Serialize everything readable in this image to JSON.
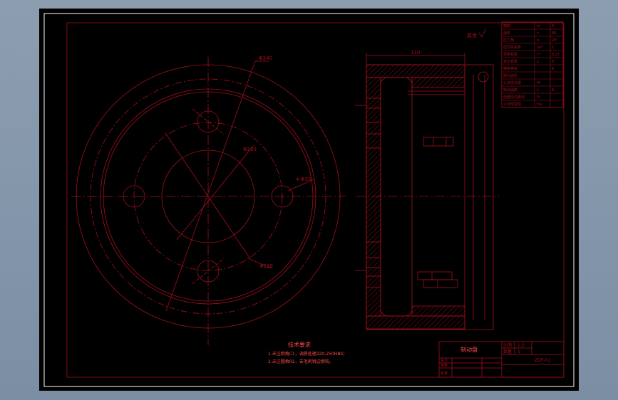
{
  "colors": {
    "frame_background": "#000000",
    "drawing_lines": "#a3101a",
    "outer_background": "#8b9bb0",
    "paper_border": "#ffffff"
  },
  "drawing": {
    "roughness_note": "其余",
    "dim_outer_diameter": "Φ340",
    "dim_pitch_circle": "Φ200",
    "dim_hole_spec": "4-Φ30",
    "dim_bore": "Φ120",
    "dim_width": "110"
  },
  "parameter_table": {
    "rows": [
      {
        "label": "模数",
        "code": "m",
        "value": "4"
      },
      {
        "label": "齿数",
        "code": "z",
        "value": "80"
      },
      {
        "label": "压力角",
        "code": "α",
        "value": "20°"
      },
      {
        "label": "齿顶高系数",
        "code": "ha*",
        "value": "1"
      },
      {
        "label": "顶隙系数",
        "code": "c*",
        "value": "0.25"
      },
      {
        "label": "变位系数",
        "code": "x",
        "value": "0"
      },
      {
        "label": "精度等级",
        "code": "",
        "value": "8"
      },
      {
        "label": "配对齿轮",
        "code": "",
        "value": ""
      },
      {
        "label": "公法线长度",
        "code": "W",
        "value": ""
      },
      {
        "label": "跨测齿数",
        "code": "k",
        "value": "9"
      },
      {
        "label": "齿圈径向跳动",
        "code": "Fr",
        "value": ""
      },
      {
        "label": "公法线变动",
        "code": "Fw",
        "value": ""
      }
    ]
  },
  "technical_requirements": {
    "title": "技术要求",
    "items": [
      "1.未注倒角C1，调质处理220-250HBS；",
      "2.未注圆角R2，去毛刺锐边倒钝。"
    ]
  },
  "title_block": {
    "part_name": "制动盘",
    "scale_label": "比例",
    "scale_value": "1:2",
    "qty_label": "数量",
    "qty_value": "1",
    "drawing_no": "ZDP-01",
    "designer_label": "设计",
    "checker_label": "审核",
    "approver_label": "批准"
  }
}
